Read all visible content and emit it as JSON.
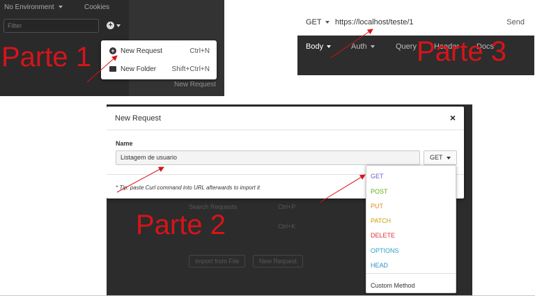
{
  "panel1": {
    "environment": "No Environment",
    "cookies": "Cookies",
    "filter_placeholder": "Filter",
    "menu": [
      {
        "label": "New Request",
        "shortcut": "Ctrl+N",
        "icon": "plus-circle-icon"
      },
      {
        "label": "New Folder",
        "shortcut": "Shift+Ctrl+N",
        "icon": "folder-icon"
      }
    ],
    "background_button": "New Request"
  },
  "panel3": {
    "method": "GET",
    "url": "https://localhost/teste/1",
    "send": "Send",
    "tabs": [
      "Body",
      "Auth",
      "Query",
      "Header",
      "Docs"
    ]
  },
  "panel2": {
    "dialog_title": "New Request",
    "close_glyph": "×",
    "name_label": "Name",
    "name_value": "Listagem de usuario",
    "method_button": "GET",
    "tip": "* Tip: paste Curl command into URL afterwards to import it",
    "methods": [
      {
        "label": "GET",
        "color": "#6c5fc7"
      },
      {
        "label": "POST",
        "color": "#5fb300"
      },
      {
        "label": "PUT",
        "color": "#e08a1e"
      },
      {
        "label": "PATCH",
        "color": "#c9a000"
      },
      {
        "label": "DELETE",
        "color": "#e0303a"
      },
      {
        "label": "OPTIONS",
        "color": "#2a9fc9"
      },
      {
        "label": "HEAD",
        "color": "#2a8fc9"
      }
    ],
    "custom_method": "Custom Method",
    "background": {
      "search_requests": "Search Requests",
      "search_shortcut": "Ctrl+P",
      "k_shortcut": "Ctrl+K",
      "import_button": "Import from File",
      "new_request_button": "New Request"
    }
  },
  "annotations": {
    "part1": "Parte 1",
    "part2": "Parte 2",
    "part3": "Parte 3",
    "color": "#d7141a"
  }
}
